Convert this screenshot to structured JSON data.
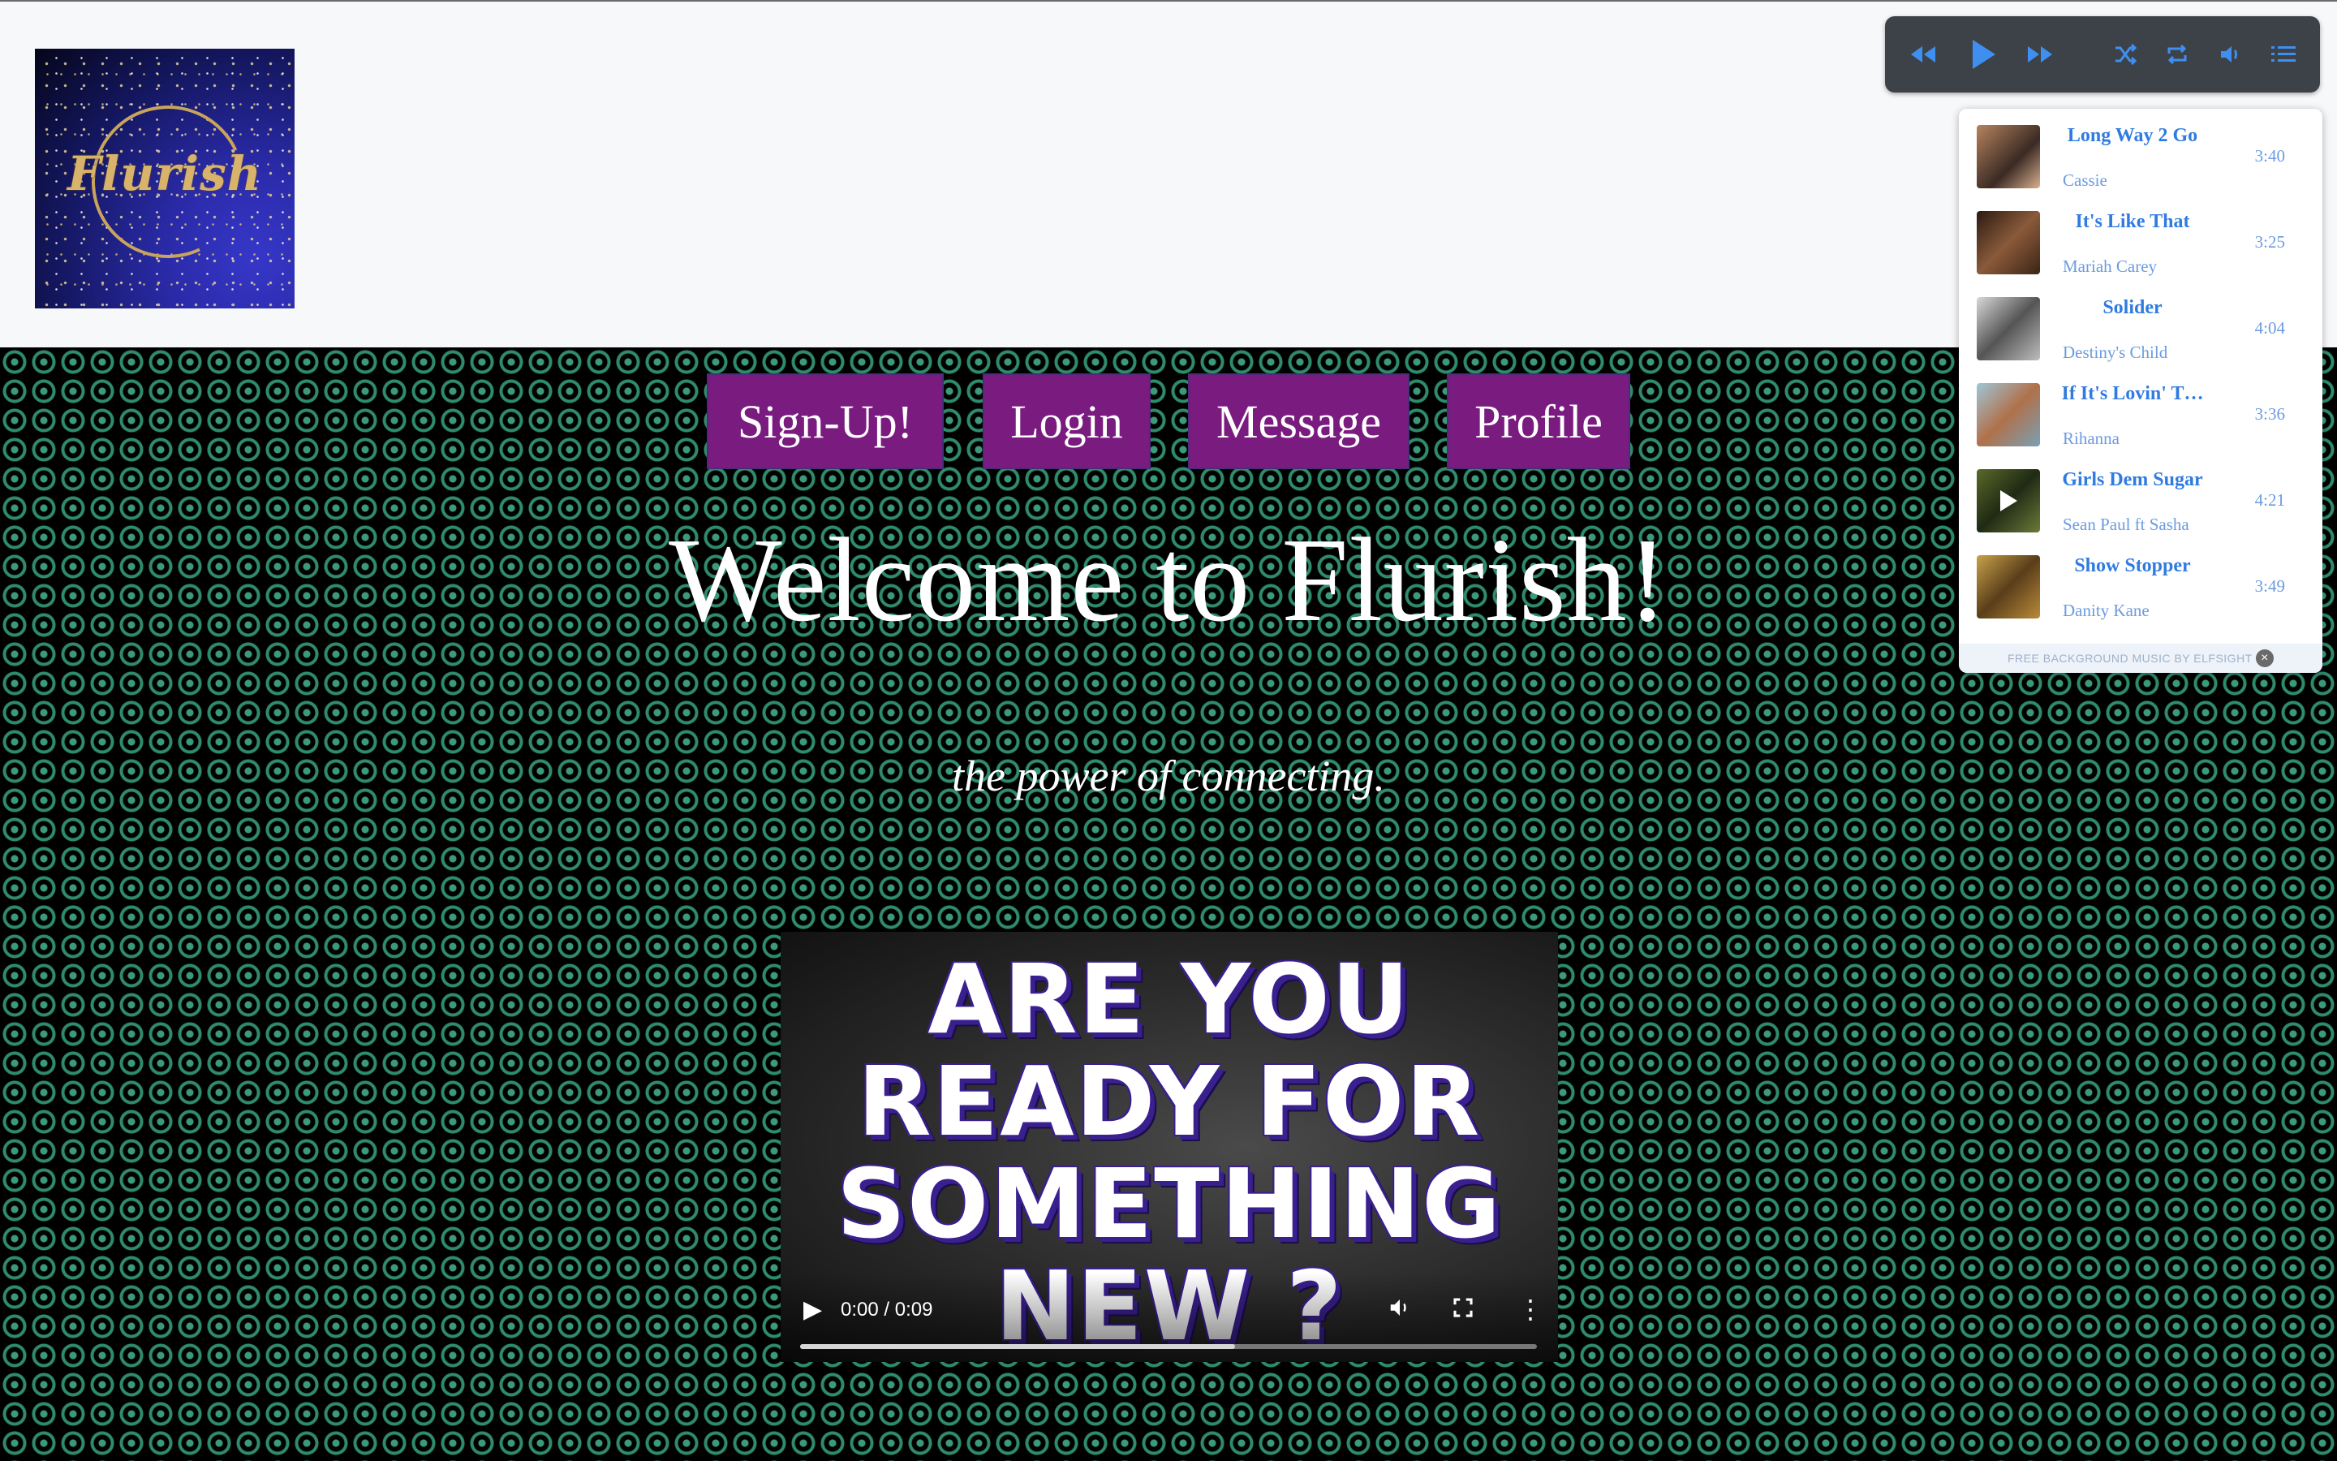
{
  "header": {
    "logo_text": "Flurish"
  },
  "nav": {
    "items": [
      {
        "label": "Sign-Up!"
      },
      {
        "label": "Login"
      },
      {
        "label": "Message"
      },
      {
        "label": "Profile"
      }
    ]
  },
  "main": {
    "title": "Welcome to Flurish!",
    "tagline": "the power of connecting."
  },
  "video": {
    "overlay_lines": [
      "ARE YOU",
      "READY FOR",
      "SOMETHING",
      "NEW ?"
    ],
    "time": "0:00 / 0:09",
    "progress_fraction": 0.59
  },
  "music_player": {
    "controls": [
      "rewind-icon",
      "play-icon",
      "fast-forward-icon",
      "shuffle-icon",
      "repeat-icon",
      "volume-icon",
      "playlist-icon"
    ],
    "accent_color": "#3f8ff0",
    "tracks": [
      {
        "title": "Long Way 2 Go",
        "artist": "Cassie",
        "duration": "3:40"
      },
      {
        "title": "It's Like That",
        "artist": "Mariah Carey",
        "duration": "3:25"
      },
      {
        "title": "Solider",
        "artist": "Destiny's Child",
        "duration": "4:04"
      },
      {
        "title": "If It's Lovin' T…",
        "artist": "Rihanna",
        "duration": "3:36"
      },
      {
        "title": "Girls Dem Sugar",
        "artist": "Sean Paul ft Sasha",
        "duration": "4:21"
      },
      {
        "title": "Show Stopper",
        "artist": "Danity Kane",
        "duration": "3:49"
      }
    ],
    "footer_text": "FREE BACKGROUND MUSIC BY ELFSIGHT"
  }
}
